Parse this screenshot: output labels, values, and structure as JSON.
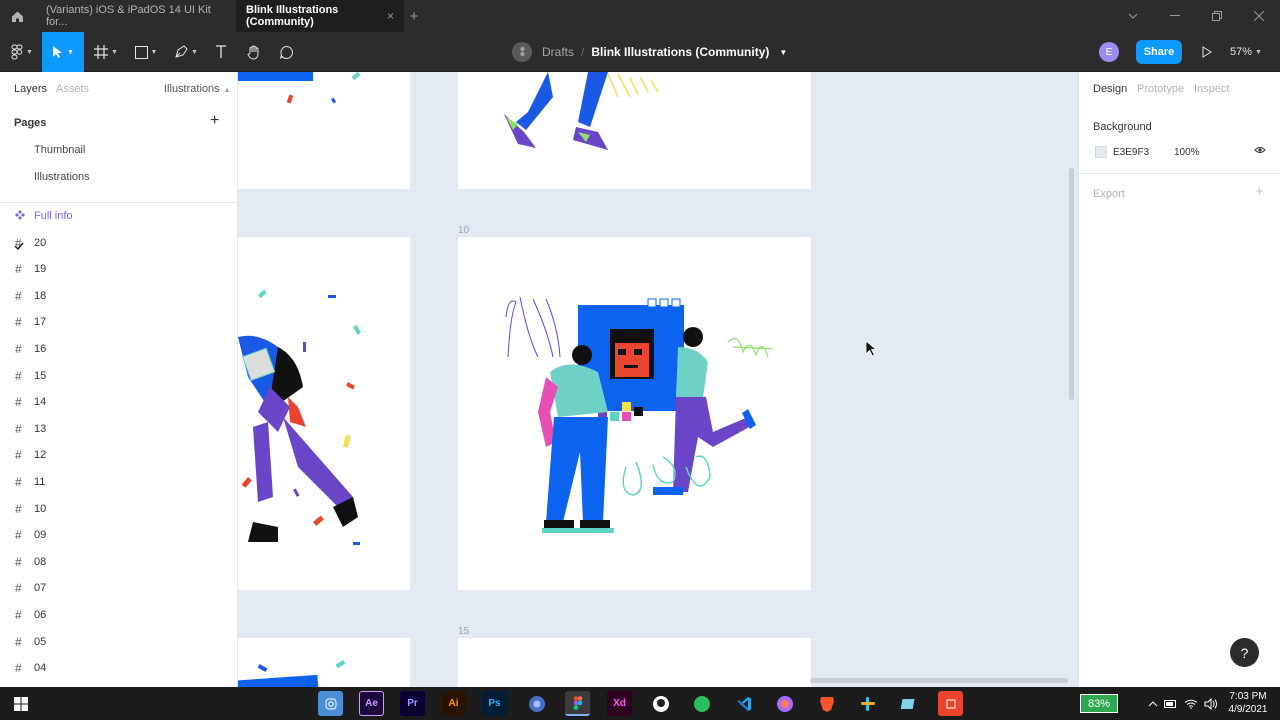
{
  "tabs": {
    "home_icon": "home-icon",
    "tab1": "(Variants) iOS & iPadOS 14 UI Kit for...",
    "tab2": "Blink Illustrations (Community)",
    "close": "×",
    "add": "+"
  },
  "toolbar": {
    "breadcrumb_parent": "Drafts",
    "breadcrumb_sep": "/",
    "file_name": "Blink Illustrations (Community)",
    "avatar_letter": "E",
    "share_label": "Share",
    "zoom_label": "57%",
    "accent": "#0d99ff"
  },
  "left_panel": {
    "tab_layers": "Layers",
    "tab_assets": "Assets",
    "page_selector": "Illustrations",
    "pages_heading": "Pages",
    "pages": [
      "Thumbnail",
      "Illustrations"
    ],
    "selected_page": "Illustrations",
    "layers": [
      "Full info",
      "20",
      "19",
      "18",
      "17",
      "16",
      "15",
      "14",
      "13",
      "12",
      "11",
      "10",
      "09",
      "08",
      "07",
      "06",
      "05",
      "04"
    ],
    "component_color": "#7b61ff"
  },
  "canvas": {
    "background": "#e3e9f3",
    "frame_labels": [
      "10",
      "15"
    ]
  },
  "right_panel": {
    "tab_design": "Design",
    "tab_prototype": "Prototype",
    "tab_inspect": "Inspect",
    "background_heading": "Background",
    "background_hex": "E3E9F3",
    "background_opacity": "100%",
    "export_heading": "Export"
  },
  "help": "?",
  "taskbar": {
    "battery": "83%",
    "time": "7:03 PM",
    "date": "4/9/2021",
    "apps": [
      "Ae",
      "Pr",
      "Ai",
      "Ps",
      "Xd"
    ]
  }
}
